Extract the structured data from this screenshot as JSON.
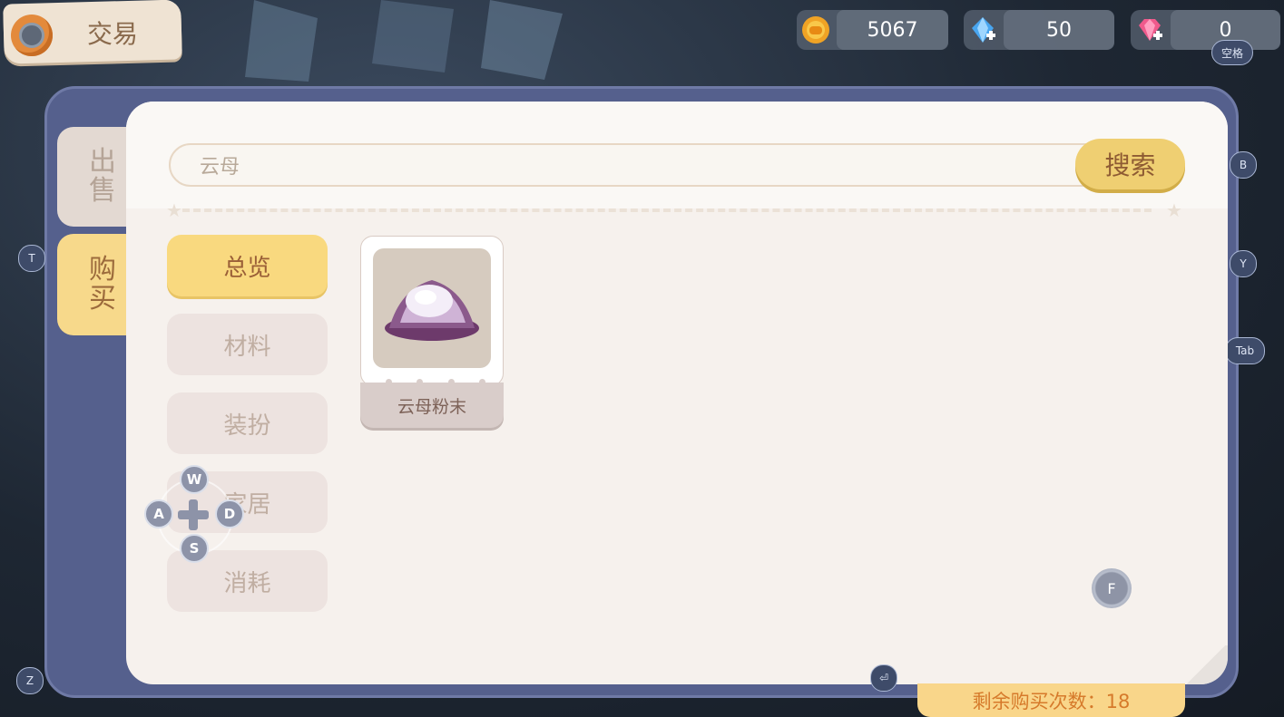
{
  "header": {
    "title": "交易"
  },
  "currencies": [
    {
      "icon": "gold-coin-icon",
      "value": "5067"
    },
    {
      "icon": "blue-crystal-add-icon",
      "value": "50"
    },
    {
      "icon": "pink-diamond-add-icon",
      "value": "0"
    }
  ],
  "hints": {
    "space": "空格",
    "b": "B",
    "t": "T",
    "y": "Y",
    "tab": "Tab",
    "z": "Z",
    "enter": "⏎",
    "f": "F",
    "w": "W",
    "a": "A",
    "s": "S",
    "d": "D"
  },
  "side_tabs": [
    {
      "label": "出售",
      "active": false
    },
    {
      "label": "购买",
      "active": true
    }
  ],
  "search": {
    "value": "云母",
    "button_label": "搜索"
  },
  "categories": [
    {
      "label": "总览",
      "active": true
    },
    {
      "label": "材料",
      "active": false
    },
    {
      "label": "装扮",
      "active": false
    },
    {
      "label": "家居",
      "active": false
    },
    {
      "label": "消耗",
      "active": false
    }
  ],
  "items": [
    {
      "name": "云母粉末",
      "icon": "mica-powder-icon"
    }
  ],
  "footer": {
    "remaining_purchases": "剩余购买次数：18"
  },
  "colors": {
    "frame": "#55608d",
    "panel": "#f6f1ed",
    "accent_yellow": "#f9d97f",
    "remaining_text": "#d67a2b"
  }
}
